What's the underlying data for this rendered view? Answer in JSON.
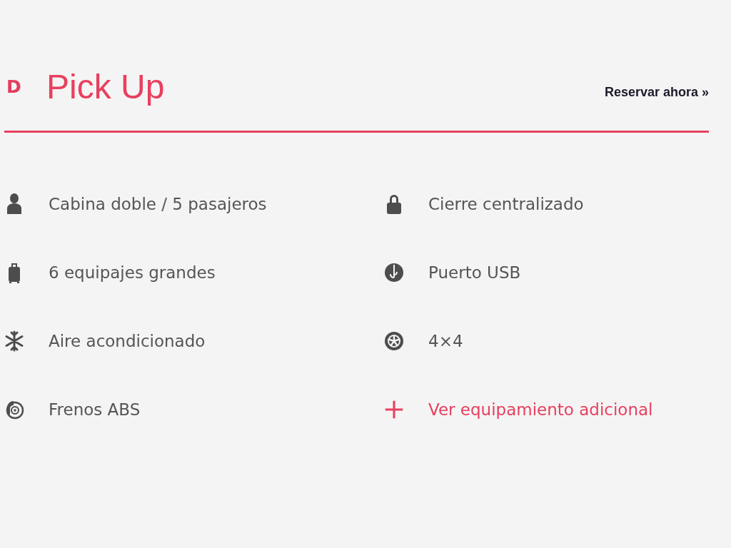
{
  "header": {
    "brand_letter": "D",
    "title": "Pick Up",
    "action": "Reservar ahora »"
  },
  "columns": [
    {
      "items": [
        {
          "kind": "feature",
          "label": "Cabina doble / 5 pasajeros"
        },
        {
          "kind": "feature",
          "label": "6 equipajes grandes"
        },
        {
          "kind": "feature",
          "label": "Aire acondicionado"
        },
        {
          "kind": "feature",
          "label": "Frenos ABS"
        }
      ]
    },
    {
      "items": [
        {
          "kind": "feature",
          "label": "Cierre centralizado"
        },
        {
          "kind": "feature",
          "label": "Puerto USB"
        },
        {
          "kind": "feature",
          "label": "4×4"
        },
        {
          "kind": "link",
          "label": "Ver equipamiento adicional"
        }
      ]
    }
  ]
}
